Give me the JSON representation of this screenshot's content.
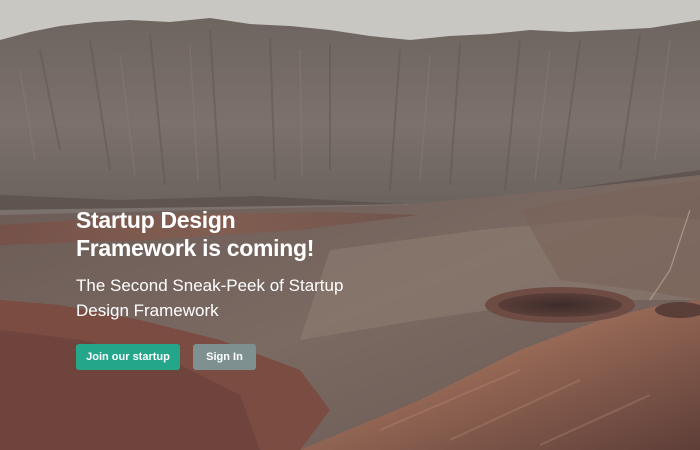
{
  "hero": {
    "title_line1": "Startup Design",
    "title_line2": "Framework is coming!",
    "subtitle": "The Second Sneak-Peek of Startup Design Framework"
  },
  "actions": {
    "primary_label": "Join our startup",
    "secondary_label": "Sign In"
  },
  "colors": {
    "primary_button": "#24a68b",
    "secondary_button": "#7e9090",
    "sky": "#c9c7c2"
  }
}
